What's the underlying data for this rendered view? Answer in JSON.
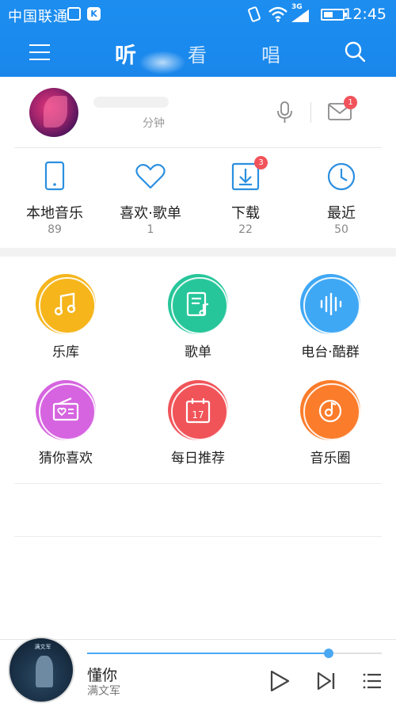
{
  "status_bar": {
    "carrier": "中国联通",
    "network": "3G",
    "time": "12:45"
  },
  "nav": {
    "tabs": [
      {
        "label": "听",
        "active": true
      },
      {
        "label": "看",
        "active": false
      },
      {
        "label": "唱",
        "active": false
      }
    ],
    "icons": [
      "menu-icon",
      "search-icon"
    ]
  },
  "profile": {
    "listen_time": "分钟",
    "mail_badge": "1"
  },
  "quick_items": [
    {
      "label": "本地音乐",
      "count": "89",
      "icon": "phone-icon"
    },
    {
      "label": "喜欢·歌单",
      "count": "1",
      "icon": "heart-icon"
    },
    {
      "label": "下载",
      "count": "22",
      "icon": "download-icon",
      "badge": "3"
    },
    {
      "label": "最近",
      "count": "50",
      "icon": "clock-icon"
    }
  ],
  "features": [
    {
      "label": "乐库",
      "icon": "music-note-icon",
      "color": "#f5b51b"
    },
    {
      "label": "歌单",
      "icon": "playlist-icon",
      "color": "#27c69a"
    },
    {
      "label": "电台·酷群",
      "icon": "soundwave-icon",
      "color": "#3fa8f5"
    },
    {
      "label": "猜你喜欢",
      "icon": "radio-icon",
      "color": "#d664e0"
    },
    {
      "label": "每日推荐",
      "icon": "calendar-icon",
      "calendar_day": "17",
      "color": "#f05459"
    },
    {
      "label": "音乐圈",
      "icon": "music-disc-icon",
      "color": "#fb7c2b"
    }
  ],
  "player": {
    "song": "懂你",
    "artist": "满文军",
    "album_text": "满文军",
    "progress": 0.82,
    "accent": "#4aa8f2"
  },
  "colors": {
    "header": "#1a8aee",
    "badge": "#f2525a",
    "icon_blue": "#2b8fe0"
  }
}
